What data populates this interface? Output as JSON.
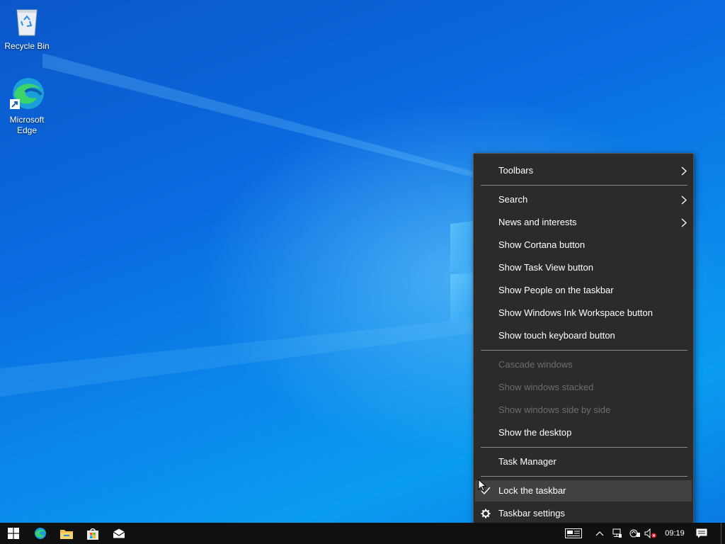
{
  "desktop": {
    "icons": [
      {
        "label": "Recycle Bin",
        "icon": "recycle-bin-icon"
      },
      {
        "label": "Microsoft Edge",
        "icon": "edge-icon"
      }
    ]
  },
  "context_menu": {
    "items": [
      {
        "label": "Toolbars",
        "submenu": true,
        "enabled": true
      },
      {
        "label": "Search",
        "submenu": true,
        "enabled": true
      },
      {
        "label": "News and interests",
        "submenu": true,
        "enabled": true
      },
      {
        "label": "Show Cortana button",
        "enabled": true
      },
      {
        "label": "Show Task View button",
        "enabled": true
      },
      {
        "label": "Show People on the taskbar",
        "enabled": true
      },
      {
        "label": "Show Windows Ink Workspace button",
        "enabled": true
      },
      {
        "label": "Show touch keyboard button",
        "enabled": true
      },
      {
        "label": "Cascade windows",
        "enabled": false
      },
      {
        "label": "Show windows stacked",
        "enabled": false
      },
      {
        "label": "Show windows side by side",
        "enabled": false
      },
      {
        "label": "Show the desktop",
        "enabled": true
      },
      {
        "label": "Task Manager",
        "enabled": true
      },
      {
        "label": "Lock the taskbar",
        "enabled": true,
        "checked": true,
        "highlighted": true
      },
      {
        "label": "Taskbar settings",
        "enabled": true,
        "icon": "gear-icon"
      }
    ]
  },
  "taskbar": {
    "pinned": [
      {
        "name": "start-button",
        "icon": "windows-logo-icon"
      },
      {
        "name": "edge",
        "icon": "edge-icon"
      },
      {
        "name": "file-explorer",
        "icon": "folder-icon"
      },
      {
        "name": "microsoft-store",
        "icon": "store-icon"
      },
      {
        "name": "mail",
        "icon": "mail-icon"
      }
    ],
    "tray_icons": [
      "news-icon",
      "chevron-up-icon",
      "network-icon",
      "sync-icon",
      "volume-muted-icon"
    ],
    "clock": "09:19",
    "notification_icon": "action-center-icon"
  },
  "colors": {
    "menu_bg": "#2b2b2b",
    "menu_highlight": "#414141",
    "taskbar_bg": "#101010",
    "accent": "#0a6fd8"
  }
}
